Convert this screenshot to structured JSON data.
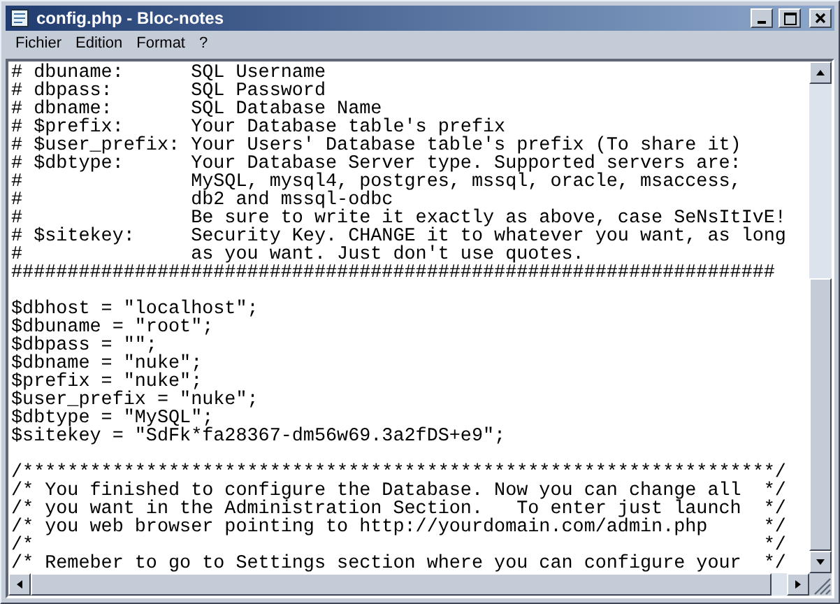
{
  "window": {
    "title": "config.php - Bloc-notes"
  },
  "menu": [
    "Fichier",
    "Edition",
    "Format",
    "?"
  ],
  "editor": {
    "header_comment": [
      "# dbuname:      SQL Username",
      "# dbpass:       SQL Password",
      "# dbname:       SQL Database Name",
      "# $prefix:      Your Database table's prefix",
      "# $user_prefix: Your Users' Database table's prefix (To share it)",
      "# $dbtype:      Your Database Server type. Supported servers are:",
      "#               MySQL, mysql4, postgres, mssql, oracle, msaccess,",
      "#               db2 and mssql-odbc",
      "#               Be sure to write it exactly as above, case SeNsItIvE!",
      "# $sitekey:     Security Key. CHANGE it to whatever you want, as long",
      "#               as you want. Just don't use quotes."
    ],
    "hash_rule": "####################################################################",
    "assignments": [
      "$dbhost = \"localhost\";",
      "$dbuname = \"root\";",
      "$dbpass = \"\";",
      "$dbname = \"nuke\";",
      "$prefix = \"nuke\";",
      "$user_prefix = \"nuke\";",
      "$dbtype = \"MySQL\";",
      "$sitekey = \"SdFk*fa28367-dm56w69.3a2fDS+e9\";"
    ],
    "footer_comment": [
      "/*******************************************************************/",
      "/* You finished to configure the Database. Now you can change all  */",
      "/* you want in the Administration Section.   To enter just launch  */",
      "/* you web browser pointing to http://yourdomain.com/admin.php     */",
      "/*                                                                 */",
      "/* Remeber to go to Settings section where you can configure your  */"
    ]
  }
}
